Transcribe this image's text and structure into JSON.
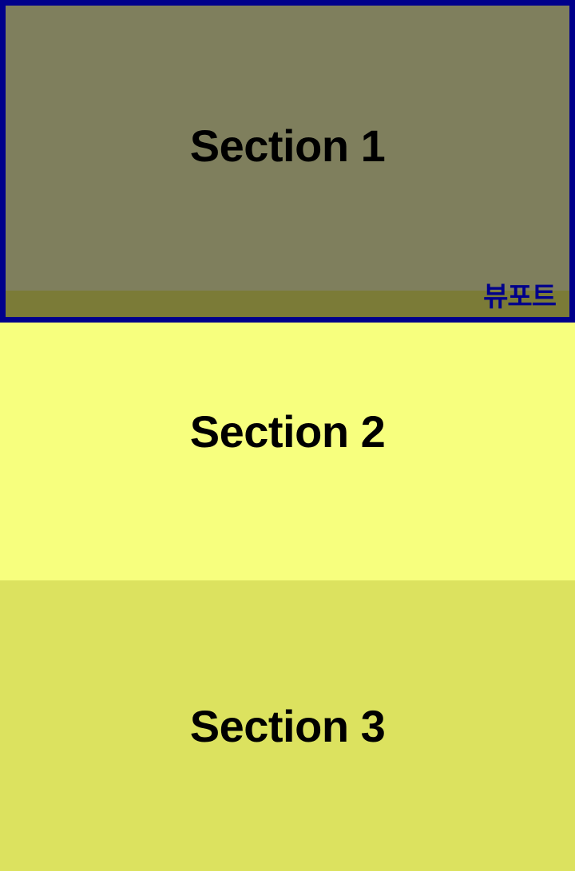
{
  "sections": [
    {
      "title": "Section 1",
      "color": "#7f7f5d"
    },
    {
      "title": "Section 2",
      "color": "#f7ff7e"
    },
    {
      "title": "Section 3",
      "color": "#dce25f"
    }
  ],
  "viewport": {
    "label": "뷰포트",
    "border_color": "#00008b"
  }
}
